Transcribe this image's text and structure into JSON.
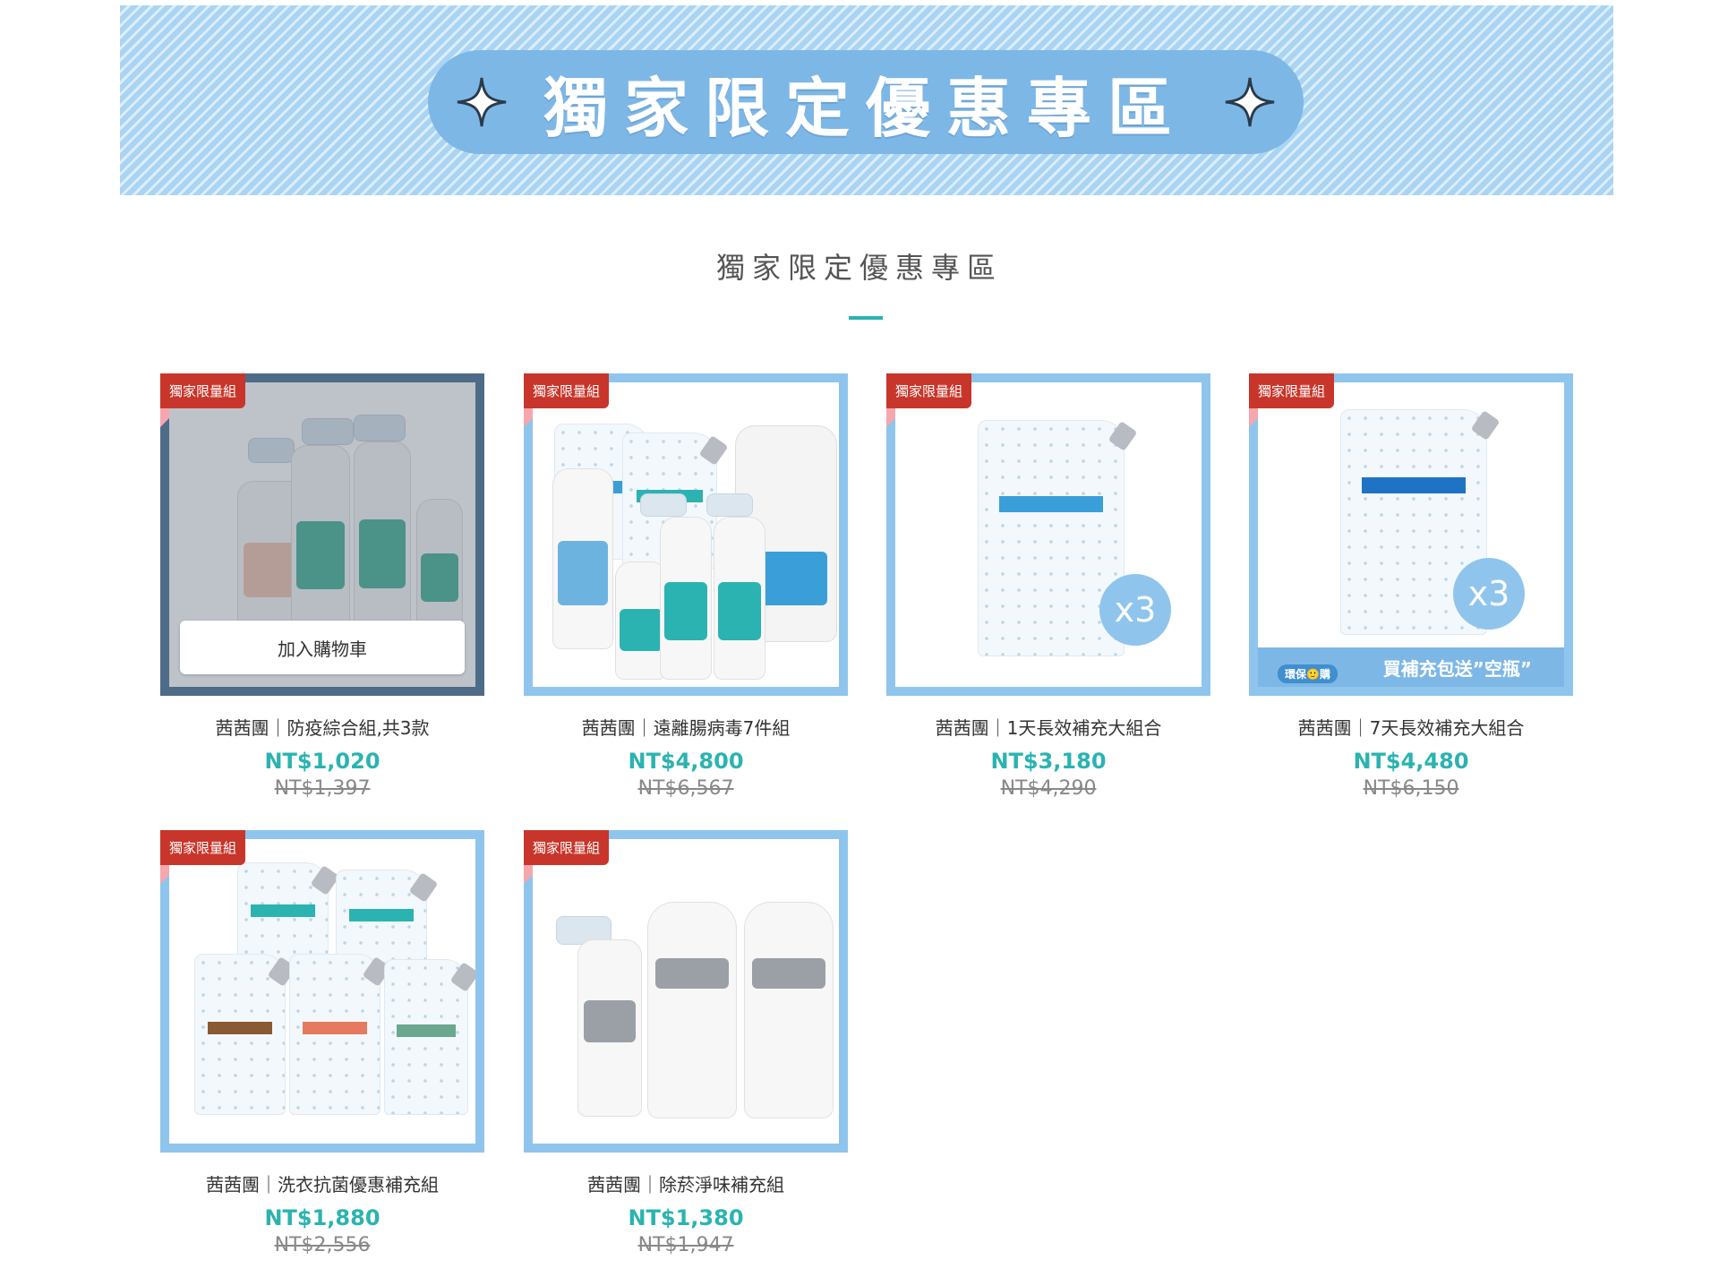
{
  "banner": {
    "title": "獨家限定優惠專區"
  },
  "section": {
    "title": "獨家限定優惠專區"
  },
  "colors": {
    "accent": "#2bb3b1",
    "frame": "#8fc5ed",
    "badge": "#c8352a",
    "banner": "#7db7e6"
  },
  "products": [
    {
      "badge": "獨家限量組",
      "name": "茜茜團｜防疫綜合組,共3款",
      "price": "NT$1,020",
      "original_price": "NT$1,397",
      "cart_button": "加入購物車"
    },
    {
      "badge": "獨家限量組",
      "name": "茜茜團｜遠離腸病毒7件組",
      "price": "NT$4,800",
      "original_price": "NT$6,567"
    },
    {
      "badge": "獨家限量組",
      "name": "茜茜團｜1天長效補充大組合",
      "price": "NT$3,180",
      "original_price": "NT$4,290",
      "multiplier": "x3"
    },
    {
      "badge": "獨家限量組",
      "name": "茜茜團｜7天長效補充大組合",
      "price": "NT$4,480",
      "original_price": "NT$6,150",
      "multiplier": "x3",
      "promo_text": "買補充包送”空瓶”",
      "eco_tag": "環保🙂購"
    },
    {
      "badge": "獨家限量組",
      "name": "茜茜團｜洗衣抗菌優惠補充組",
      "price": "NT$1,880",
      "original_price": "NT$2,556"
    },
    {
      "badge": "獨家限量組",
      "name": "茜茜團｜除菸淨味補充組",
      "price": "NT$1,380",
      "original_price": "NT$1,947"
    }
  ]
}
